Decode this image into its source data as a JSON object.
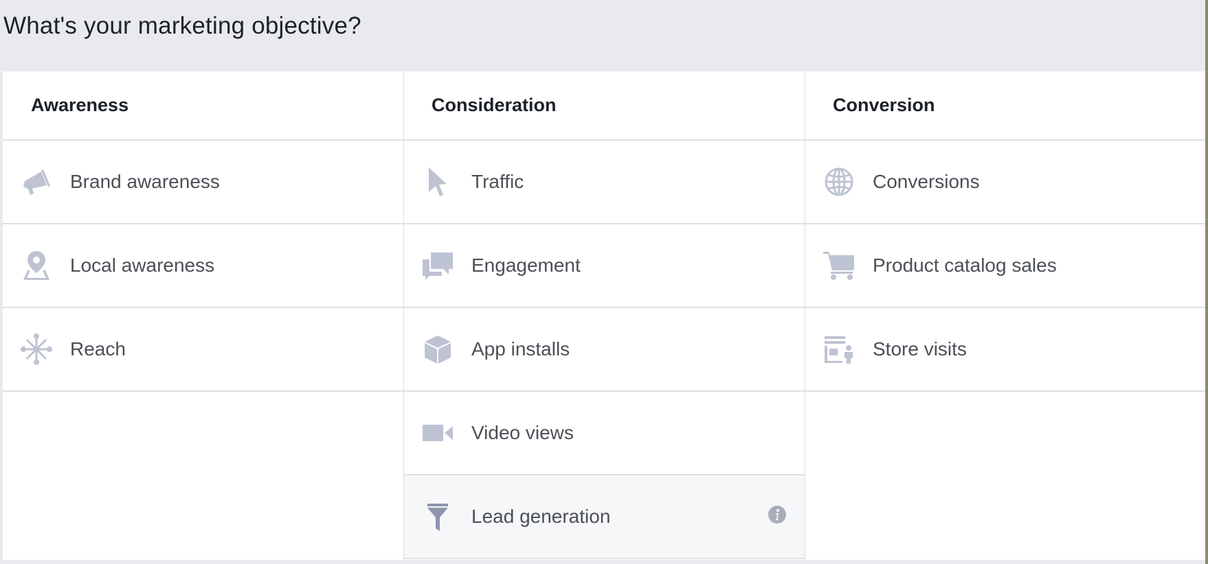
{
  "title": "What's your marketing objective?",
  "columns": [
    {
      "header": "Awareness",
      "items": [
        {
          "label": "Brand awareness",
          "icon": "megaphone-icon"
        },
        {
          "label": "Local awareness",
          "icon": "map-pin-icon"
        },
        {
          "label": "Reach",
          "icon": "reach-network-icon"
        }
      ]
    },
    {
      "header": "Consideration",
      "items": [
        {
          "label": "Traffic",
          "icon": "cursor-icon"
        },
        {
          "label": "Engagement",
          "icon": "speech-bubbles-icon"
        },
        {
          "label": "App installs",
          "icon": "box-icon"
        },
        {
          "label": "Video views",
          "icon": "video-camera-icon"
        },
        {
          "label": "Lead generation",
          "icon": "funnel-icon",
          "selected": true,
          "info_icon": "info-icon"
        }
      ]
    },
    {
      "header": "Conversion",
      "items": [
        {
          "label": "Conversions",
          "icon": "globe-icon"
        },
        {
          "label": "Product catalog sales",
          "icon": "shopping-cart-icon"
        },
        {
          "label": "Store visits",
          "icon": "store-person-icon"
        }
      ]
    }
  ],
  "colors": {
    "icon": "#bec3d3",
    "icon_selected": "#8d94ad",
    "header_text": "#1d2129",
    "item_text": "#4b4f56",
    "divider": "#dddfe2",
    "background": "#e9eaed",
    "selected_background": "#f6f7f9"
  }
}
